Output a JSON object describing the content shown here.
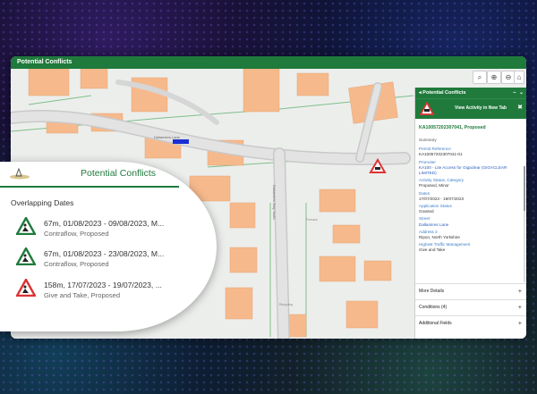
{
  "app": {
    "title": "Potential Conflicts"
  },
  "map": {
    "streets": [
      "Dallamires Lane",
      "Dallamires Way North"
    ],
    "places": [
      "Furnace",
      "Recycling",
      "Works",
      "Nurses"
    ],
    "controls": [
      "search-icon",
      "zoom-in-icon",
      "zoom-out-icon",
      "layers-icon"
    ]
  },
  "panel": {
    "header": "Potential Conflicts",
    "view_activity": "View Activity in New Tab",
    "reference": "KA10057202307041, Proposed",
    "section": "Summary",
    "fields": [
      {
        "label": "Permit Reference",
        "value": "KA10057202307041-01",
        "link": false
      },
      {
        "label": "Promoter",
        "value": "KA100 - Lite Access for Gigaclear (GIGACLEAR LIMITED)",
        "link": true
      },
      {
        "label": "Activity Status, Category",
        "value": "Proposed, Minor",
        "link": false
      },
      {
        "label": "Dates",
        "value": "17/07/2023 - 19/07/2023",
        "link": false
      },
      {
        "label": "Application Status",
        "value": "Granted",
        "link": false
      },
      {
        "label": "Street",
        "value": "Dallamires Lane",
        "link": true
      },
      {
        "label": "Address 2",
        "value": "Ripon, North Yorkshire",
        "link": false
      },
      {
        "label": "Highest Traffic Management",
        "value": "Give and Take",
        "link": false
      }
    ],
    "accordions": [
      "More Details",
      "Conditions (4)",
      "Additional Fields"
    ]
  },
  "bubble": {
    "title": "Potential Conflicts",
    "subtitle": "Overlapping Dates",
    "conflicts": [
      {
        "line1": "67m, 01/08/2023 - 09/08/2023, M...",
        "line2": "Contraflow, Proposed",
        "icon": "roadworks-green-icon"
      },
      {
        "line1": "67m, 01/08/2023 - 23/08/2023, M...",
        "line2": "Contraflow, Proposed",
        "icon": "roadworks-green-icon"
      },
      {
        "line1": "158m, 17/07/2023 - 19/07/2023, ...",
        "line2": "Give and Take, Proposed",
        "icon": "roadworks-red-icon"
      }
    ]
  },
  "colors": {
    "brand_green": "#1f7a3c",
    "building": "#f6b98c",
    "road": "#c9c9c9"
  }
}
